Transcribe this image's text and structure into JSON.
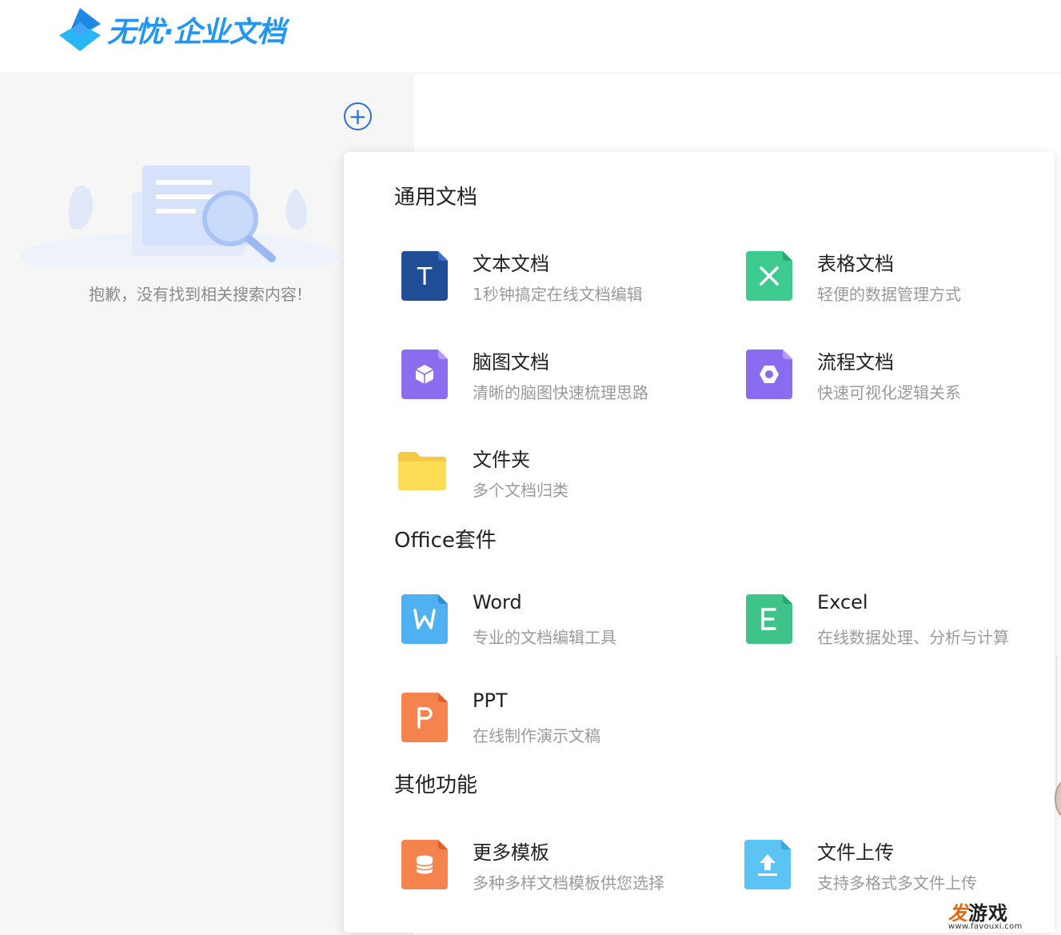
{
  "brand": {
    "logo_text": "无忧·企业文档",
    "accent": "#2196f3"
  },
  "sidebar": {
    "empty_message": "抱歉，没有找到相关搜索内容!"
  },
  "popup": {
    "sections": [
      {
        "title": "通用文档",
        "items": [
          {
            "name": "文本文档",
            "desc": "1秒钟搞定在线文档编辑",
            "icon": "text-doc-icon",
            "color": "#1f4e96",
            "glyph": "T"
          },
          {
            "name": "表格文档",
            "desc": "轻便的数据管理方式",
            "icon": "sheet-doc-icon",
            "color": "#3ecb8f",
            "glyph": "×"
          },
          {
            "name": "脑图文档",
            "desc": "清晰的脑图快速梳理思路",
            "icon": "mindmap-doc-icon",
            "color": "#8b6ef0",
            "glyph": ""
          },
          {
            "name": "流程文档",
            "desc": "快速可视化逻辑关系",
            "icon": "flow-doc-icon",
            "color": "#8a6cf0",
            "glyph": ""
          },
          {
            "name": "文件夹",
            "desc": "多个文档归类",
            "icon": "folder-icon",
            "color": "#ffd94f",
            "glyph": ""
          }
        ]
      },
      {
        "title": "Office套件",
        "items": [
          {
            "name": "Word",
            "desc": "专业的文档编辑工具",
            "icon": "word-icon",
            "color": "#4fb0f2",
            "glyph": "W"
          },
          {
            "name": "Excel",
            "desc": "在线数据处理、分析与计算",
            "icon": "excel-icon",
            "color": "#3ec48b",
            "glyph": "E"
          },
          {
            "name": "PPT",
            "desc": "在线制作演示文稿",
            "icon": "ppt-icon",
            "color": "#f5834e",
            "glyph": "P"
          }
        ]
      },
      {
        "title": "其他功能",
        "items": [
          {
            "name": "更多模板",
            "desc": "多种多样文档模板供您选择",
            "icon": "template-icon",
            "color": "#f5834e",
            "glyph": ""
          },
          {
            "name": "文件上传",
            "desc": "支持多格式多文件上传",
            "icon": "upload-icon",
            "color": "#5cc3f5",
            "glyph": ""
          }
        ]
      }
    ]
  },
  "watermark": {
    "main_a": "发",
    "main_b": "游戏",
    "sub": "www.favouxi.com"
  }
}
